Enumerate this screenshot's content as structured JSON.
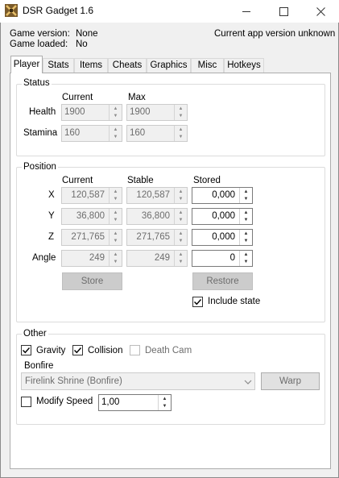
{
  "window": {
    "title": "DSR Gadget 1.6"
  },
  "header": {
    "game_version_label": "Game version:",
    "game_version_value": "None",
    "game_loaded_label": "Game loaded:",
    "game_loaded_value": "No",
    "app_version_text": "Current app version unknown"
  },
  "tabs": [
    {
      "label": "Player",
      "active": true
    },
    {
      "label": "Stats"
    },
    {
      "label": "Items"
    },
    {
      "label": "Cheats"
    },
    {
      "label": "Graphics"
    },
    {
      "label": "Misc"
    },
    {
      "label": "Hotkeys"
    }
  ],
  "status": {
    "title": "Status",
    "col_current": "Current",
    "col_max": "Max",
    "rows": [
      {
        "label": "Health",
        "current": "1900",
        "max": "1900"
      },
      {
        "label": "Stamina",
        "current": "160",
        "max": "160"
      }
    ]
  },
  "position": {
    "title": "Position",
    "col_current": "Current",
    "col_stable": "Stable",
    "col_stored": "Stored",
    "rows": [
      {
        "label": "X",
        "current": "120,587",
        "stable": "120,587",
        "stored": "0,000"
      },
      {
        "label": "Y",
        "current": "36,800",
        "stable": "36,800",
        "stored": "0,000"
      },
      {
        "label": "Z",
        "current": "271,765",
        "stable": "271,765",
        "stored": "0,000"
      },
      {
        "label": "Angle",
        "current": "249",
        "stable": "249",
        "stored": "0"
      }
    ],
    "store_label": "Store",
    "restore_label": "Restore",
    "include_state_label": "Include state",
    "include_state_checked": true
  },
  "other": {
    "title": "Other",
    "gravity_label": "Gravity",
    "gravity_checked": true,
    "collision_label": "Collision",
    "collision_checked": true,
    "death_cam_label": "Death Cam",
    "death_cam_checked": false,
    "bonfire_label": "Bonfire",
    "bonfire_value": "Firelink Shrine (Bonfire)",
    "warp_label": "Warp",
    "modify_speed_label": "Modify Speed",
    "modify_speed_checked": false,
    "speed_value": "1,00"
  },
  "colors": {
    "window_bg": "#f0f0f0",
    "panel_bg": "#ffffff",
    "disabled_text": "#6d6d6d"
  }
}
